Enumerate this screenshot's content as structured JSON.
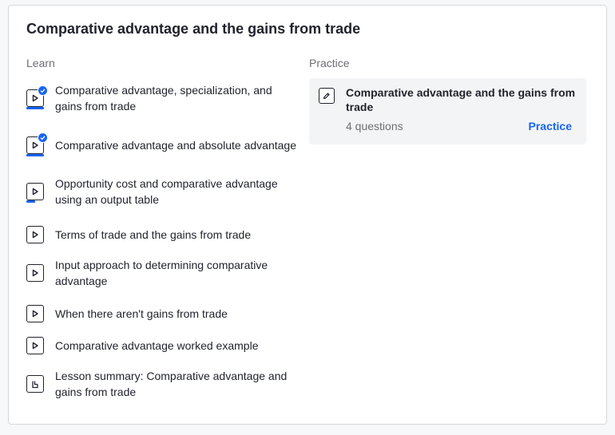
{
  "unit": {
    "title": "Comparative advantage and the gains from trade"
  },
  "learn": {
    "heading": "Learn",
    "items": [
      {
        "label": "Comparative advantage, specialization, and gains from trade",
        "type": "video",
        "icon": "play-icon",
        "progress": 1.0,
        "completed": true
      },
      {
        "label": "Comparative advantage and absolute advantage",
        "type": "video",
        "icon": "play-icon",
        "progress": 1.0,
        "completed": true
      },
      {
        "label": "Opportunity cost and comparative advantage using an output table",
        "type": "video",
        "icon": "play-icon",
        "progress": 0.5,
        "completed": false
      },
      {
        "label": "Terms of trade and the gains from trade",
        "type": "video",
        "icon": "play-icon",
        "progress": 0,
        "completed": false
      },
      {
        "label": "Input approach to determining comparative advantage",
        "type": "video",
        "icon": "play-icon",
        "progress": 0,
        "completed": false
      },
      {
        "label": "When there aren't gains from trade",
        "type": "video",
        "icon": "play-icon",
        "progress": 0,
        "completed": false
      },
      {
        "label": "Comparative advantage worked example",
        "type": "video",
        "icon": "play-icon",
        "progress": 0,
        "completed": false
      },
      {
        "label": "Lesson summary: Comparative advantage and gains from trade",
        "type": "article",
        "icon": "article-icon",
        "progress": 0,
        "completed": false
      }
    ]
  },
  "practice": {
    "heading": "Practice",
    "exercise": {
      "title": "Comparative advantage and the gains from trade",
      "questions": "4 questions",
      "link_label": "Practice",
      "icon": "pencil-icon"
    }
  },
  "colors": {
    "accent": "#1865f2",
    "text": "#21242c",
    "muted": "#6d6f74",
    "card_bg": "#f3f4f5"
  }
}
